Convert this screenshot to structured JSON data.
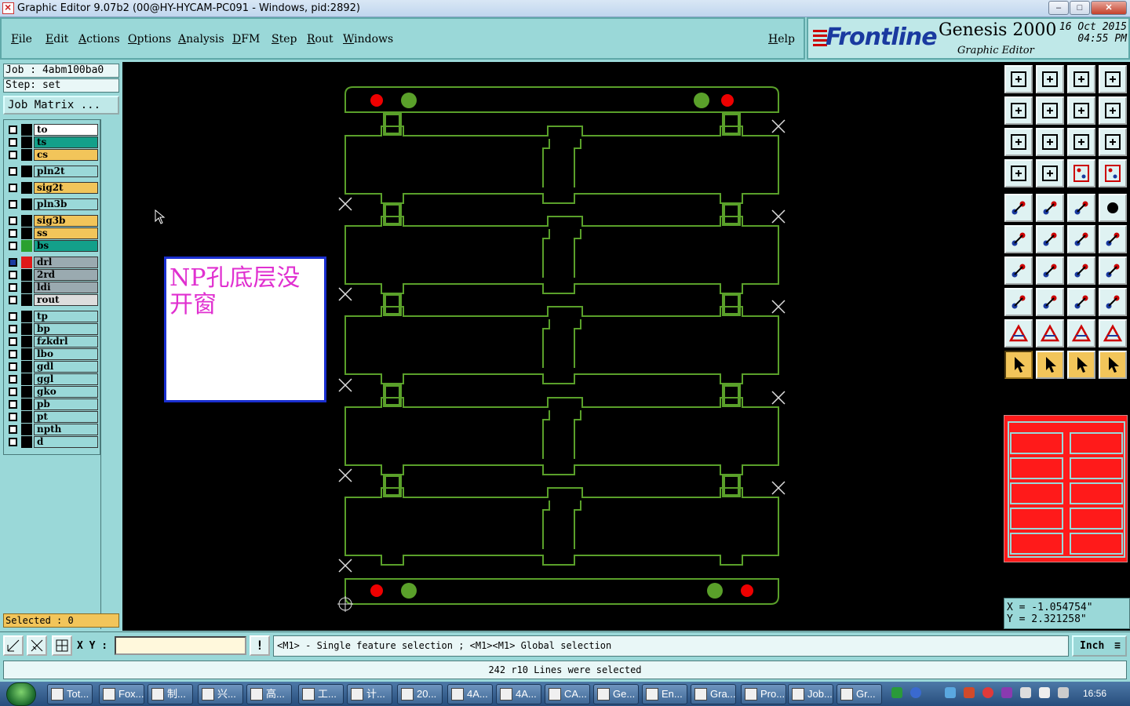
{
  "window": {
    "title": "Graphic Editor 9.07b2 (00@HY-HYCAM-PC091 - Windows, pid:2892)",
    "controls": [
      "–",
      "□",
      "✕"
    ]
  },
  "menu": {
    "items": [
      "File",
      "Edit",
      "Actions",
      "Options",
      "Analysis",
      "DFM",
      "Step",
      "Rout",
      "Windows"
    ],
    "help": "Help"
  },
  "logo": {
    "brand": "Frontline",
    "product": "Genesis 2000",
    "subtitle": "Graphic Editor",
    "date": "16 Oct 2015",
    "time": "04:55 PM"
  },
  "job": {
    "job_line": "Job : 4abm100ba0",
    "step_line": "Step: set",
    "matrix_button": "Job Matrix ...",
    "selected": "Selected : 0"
  },
  "layers": [
    {
      "name": "to",
      "color": "#ffffff"
    },
    {
      "name": "ts",
      "color": "#13a08a"
    },
    {
      "name": "cs",
      "color": "#f2c55a"
    },
    {
      "name": "pln2t",
      "color": "#9ad8d8"
    },
    {
      "name": "sig2t",
      "color": "#f2c55a"
    },
    {
      "name": "pln3b",
      "color": "#9ad8d8"
    },
    {
      "name": "sig3b",
      "color": "#f2c55a"
    },
    {
      "name": "ss",
      "color": "#f2c55a"
    },
    {
      "name": "bs",
      "color": "#13a08a"
    },
    {
      "name": "drl",
      "color": "#9aaab0"
    },
    {
      "name": "2rd",
      "color": "#9aaab0"
    },
    {
      "name": "ldi",
      "color": "#9aaab0"
    },
    {
      "name": "rout",
      "color": "#dddddd"
    },
    {
      "name": "tp",
      "color": "#9ad8d8"
    },
    {
      "name": "bp",
      "color": "#9ad8d8"
    },
    {
      "name": "fzkdrl",
      "color": "#9ad8d8"
    },
    {
      "name": "lbo",
      "color": "#9ad8d8"
    },
    {
      "name": "gdl",
      "color": "#9ad8d8"
    },
    {
      "name": "ggl",
      "color": "#9ad8d8"
    },
    {
      "name": "gko",
      "color": "#9ad8d8"
    },
    {
      "name": "pb",
      "color": "#9ad8d8"
    },
    {
      "name": "pt",
      "color": "#9ad8d8"
    },
    {
      "name": "npth",
      "color": "#9ad8d8"
    },
    {
      "name": "d",
      "color": "#9ad8d8"
    }
  ],
  "note": {
    "text": "NP孔底层没开窗"
  },
  "coords": {
    "x": "X = -1.054754\"",
    "y": "Y = 2.321258\""
  },
  "bottom": {
    "xy_label": "X Y :",
    "xy_value": "",
    "bang": "!",
    "hint": "<M1> - Single feature selection ; <M1><M1> Global selection",
    "units": "Inch",
    "message": "242 r10 Lines were selected"
  },
  "taskbar": {
    "items": [
      "Tot...",
      "Fox...",
      "制...",
      "兴...",
      "高...",
      "工...",
      "计...",
      "20...",
      "4A...",
      "4A...",
      "CA...",
      "Ge...",
      "En...",
      "Gra...",
      "Pro...",
      "Job...",
      "Gr..."
    ],
    "clock": "16:56"
  },
  "colors": {
    "panel": "#9ad8d8",
    "board_outline": "#5aa02a",
    "minimap": "#ff1a1a",
    "note_text": "#e030d0",
    "note_border": "#1a2fd0"
  }
}
